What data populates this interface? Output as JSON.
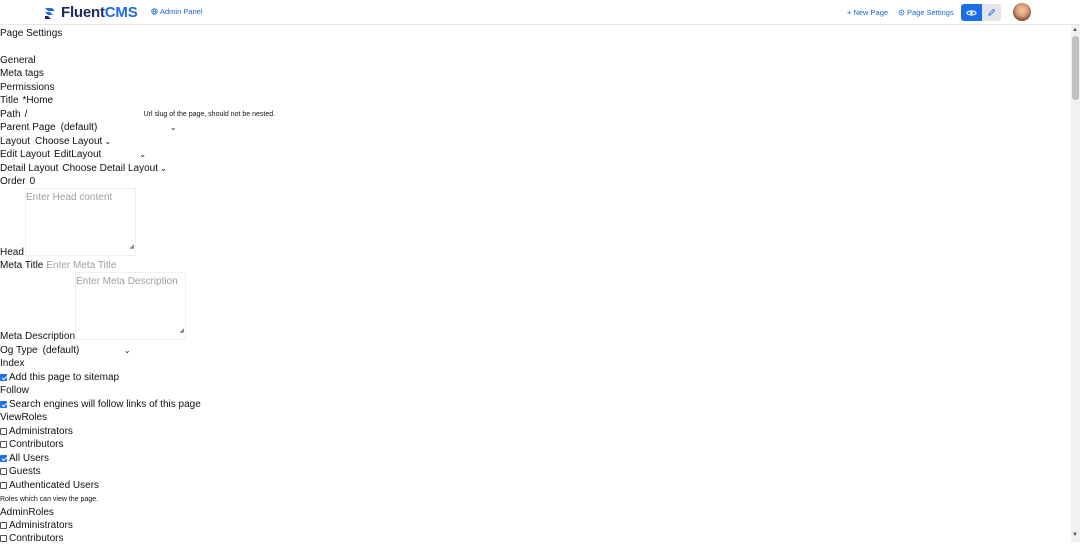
{
  "header": {
    "brand_fluent": "Fluent",
    "brand_cms": "CMS",
    "admin_panel": "Admin Panel",
    "new_page": "+ New Page",
    "page_settings": "Page Settings",
    "icons": [
      "logo-icon",
      "globe-icon",
      "settings-icon",
      "eye-icon",
      "pencil-icon"
    ]
  },
  "page": {
    "heading": "Page Settings",
    "tabs": [
      "General",
      "Meta tags",
      "Permissions"
    ],
    "fields": {
      "title_label": "Title",
      "title_value": "*Home",
      "path_label": "Path",
      "path_value": "/",
      "path_hint": "Url slug of the page, should not be nested.",
      "parent_label": "Parent Page",
      "parent_value": "(default)",
      "layout_label": "Layout",
      "layout_value": "Choose Layout",
      "edit_layout_label": "Edit Layout",
      "edit_layout_value": "EditLayout",
      "detail_layout_label": "Detail Layout",
      "detail_layout_value": "Choose Detail Layout",
      "order_label": "Order",
      "order_value": "0",
      "head_placeholder": "Enter Head content",
      "head_label": "Head",
      "meta_title_label": "Meta Title",
      "meta_title_placeholder": "Enter Meta Title",
      "meta_desc_placeholder": "Enter Meta Description",
      "meta_desc_label": "Meta Description",
      "og_type_label": "Og Type",
      "og_type_value": "(default)",
      "index_label": "Index",
      "index_check": "Add this page to sitemap",
      "follow_label": "Follow",
      "follow_check": "Search engines will follow links of this page",
      "view_roles_label": "ViewRoles",
      "view_roles": [
        {
          "label": "Administrators",
          "checked": false
        },
        {
          "label": "Contributors",
          "checked": false
        },
        {
          "label": "All Users",
          "checked": true
        },
        {
          "label": "Guests",
          "checked": false
        },
        {
          "label": "Authenticated Users",
          "checked": false
        }
      ],
      "view_roles_hint": "Roles which can view the page.",
      "admin_roles_label": "AdminRoles",
      "admin_roles": [
        {
          "label": "Administrators",
          "checked": false
        },
        {
          "label": "Contributors",
          "checked": false
        }
      ]
    }
  },
  "colors": {
    "accent": "#1c6ee8",
    "link": "#1d64d6",
    "brand_dark": "#1c2a5c"
  }
}
